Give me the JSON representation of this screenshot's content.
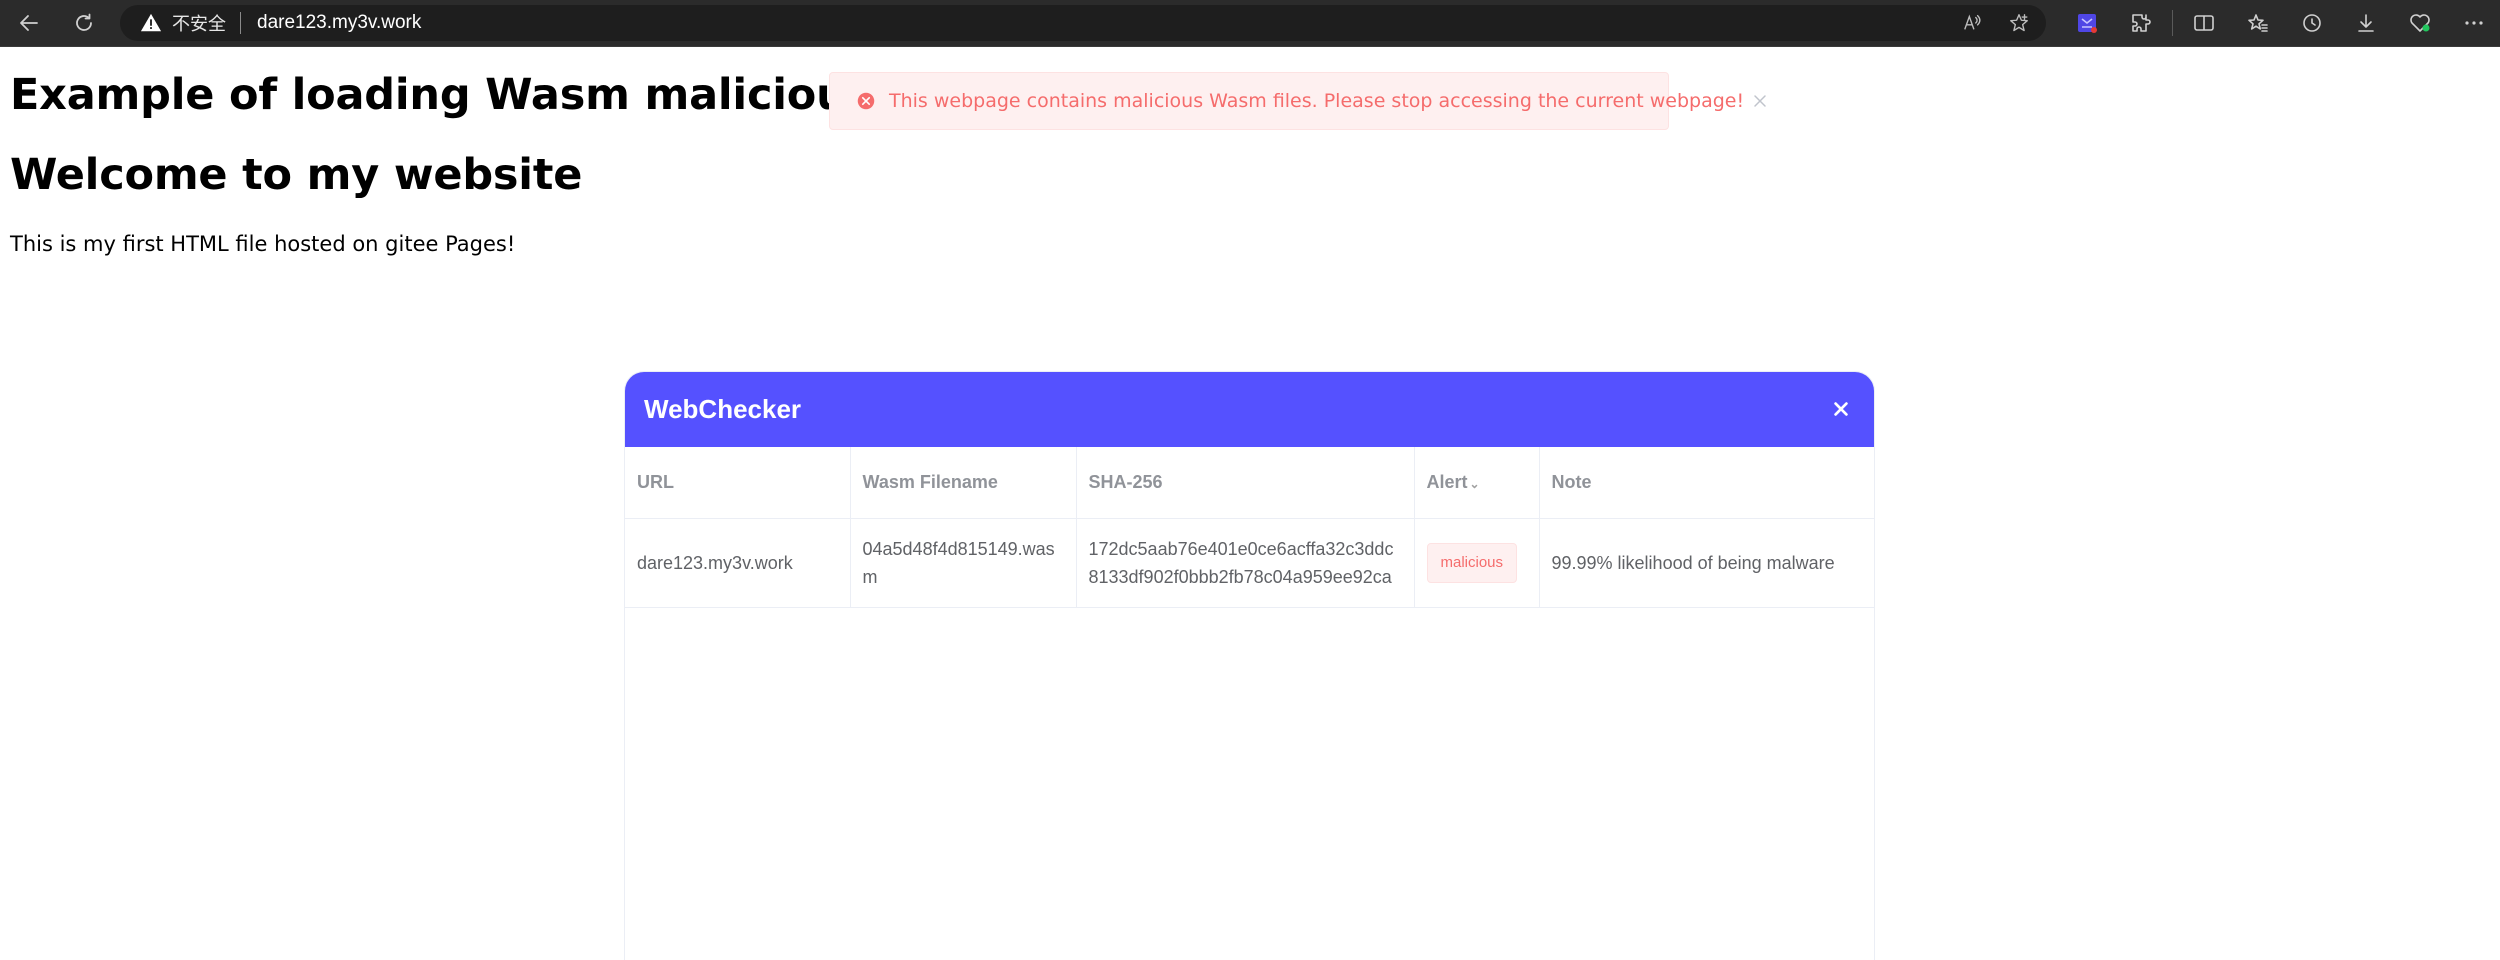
{
  "browser": {
    "insecure_label": "不安全",
    "url": "dare123.my3v.work"
  },
  "page": {
    "heading1": "Example of loading Wasm malicious file",
    "heading2": "Welcome to my website",
    "paragraph": "This is my first HTML file hosted on gitee Pages!"
  },
  "alert": {
    "message": "This webpage contains malicious Wasm files. Please stop accessing the current webpage!",
    "color": "#f56c6c"
  },
  "dialog": {
    "title": "WebChecker",
    "close_label": "×",
    "header_color": "#5551ff",
    "columns": [
      "URL",
      "Wasm Filename",
      "SHA-256",
      "Alert",
      "Note"
    ],
    "rows": [
      {
        "url": "dare123.my3v.work",
        "filename": "04a5d48f4d815149.wasm",
        "sha256": "172dc5aab76e401e0ce6acffa32c3ddc8133df902f0bbb2fb78c04a959ee92ca",
        "alert": "malicious",
        "note": "99.99% likelihood of being malware"
      }
    ]
  },
  "icons": {
    "nav": [
      "back-arrow-icon",
      "refresh-icon"
    ],
    "address_bar": [
      "warning-icon",
      "read-aloud-icon",
      "favorite-star-icon"
    ],
    "toolbar": [
      "extension-app-icon",
      "extensions-puzzle-icon",
      "split-screen-icon",
      "favorites-icon",
      "history-icon",
      "downloads-icon",
      "browser-essentials-icon",
      "more-menu-icon"
    ]
  }
}
